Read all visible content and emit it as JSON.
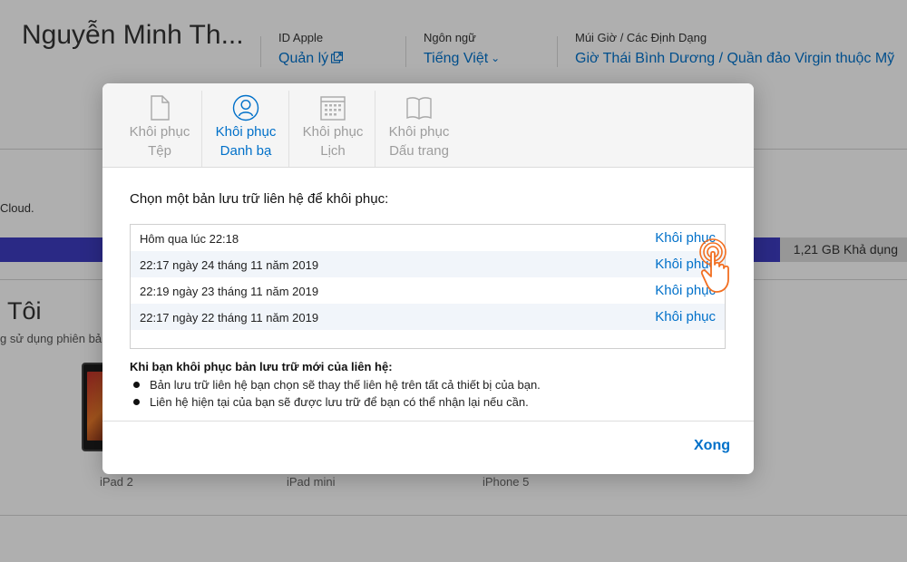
{
  "header": {
    "user_name": "Nguyễn Minh Th...",
    "apple_id": {
      "label": "ID Apple",
      "link": "Quản lý"
    },
    "language": {
      "label": "Ngôn ngữ",
      "value": "Tiếng Việt"
    },
    "timezone": {
      "label": "Múi Giờ / Các Định Dạng",
      "value": "Giờ Thái Bình Dương / Quần đảo Virgin thuộc Mỹ"
    }
  },
  "background": {
    "cloud_text": "Cloud.",
    "storage": {
      "available_text": "1,21 GB Khả dụng",
      "used_fraction": 0.86,
      "used_color": "#3d3bbf"
    },
    "devices_title": "Tôi",
    "devices_subtitle": "g sử dụng phiên bả",
    "devices": [
      "iPad 2",
      "iPad mini",
      "iPhone 5"
    ]
  },
  "modal": {
    "tabs": [
      {
        "line1": "Khôi phục",
        "line2": "Tệp",
        "icon": "document-icon",
        "active": false
      },
      {
        "line1": "Khôi phục",
        "line2": "Danh bạ",
        "icon": "contacts-icon",
        "active": true
      },
      {
        "line1": "Khôi phục",
        "line2": "Lịch",
        "icon": "calendar-icon",
        "active": false
      },
      {
        "line1": "Khôi phục",
        "line2": "Dấu trang",
        "icon": "bookmarks-icon",
        "active": false
      }
    ],
    "section_title": "Chọn một bản lưu trữ liên hệ để khôi phục:",
    "backups": [
      {
        "date": "Hôm qua lúc 22:18",
        "action": "Khôi phục"
      },
      {
        "date": "22:17 ngày 24 tháng 11 năm 2019",
        "action": "Khôi phục"
      },
      {
        "date": "22:19 ngày 23 tháng 11 năm 2019",
        "action": "Khôi phục"
      },
      {
        "date": "22:17 ngày 22 tháng 11 năm 2019",
        "action": "Khôi phục"
      }
    ],
    "note_title": "Khi bạn khôi phục bản lưu trữ mới của liên hệ:",
    "note_bullets": [
      "Bản lưu trữ liên hệ bạn chọn sẽ thay thế liên hệ trên tất cả thiết bị của bạn.",
      "Liên hệ hiện tại của bạn sẽ được lưu trữ để bạn có thể nhận lại nếu cần."
    ],
    "done_label": "Xong"
  },
  "colors": {
    "accent": "#0070c9",
    "cursor": "#f26f21",
    "inactive_tab": "#9d9d9d"
  }
}
